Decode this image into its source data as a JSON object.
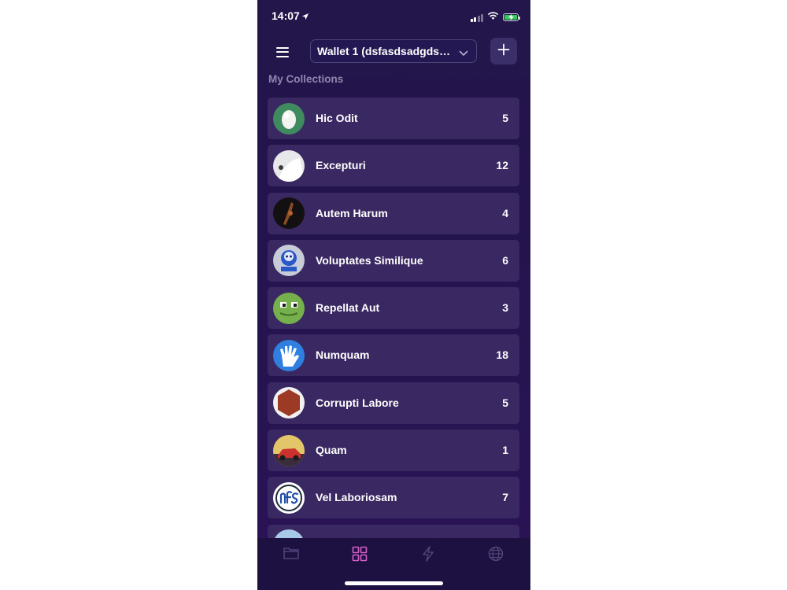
{
  "status_bar": {
    "time": "14:07"
  },
  "header": {
    "wallet_label": "Wallet 1 (dsfasdsadgdsff..."
  },
  "section": {
    "title": "My Collections"
  },
  "collections": [
    {
      "name": "Hic Odit",
      "count": "5",
      "avatar": "egg-avatar"
    },
    {
      "name": "Excepturi",
      "count": "12",
      "avatar": "white-object-avatar"
    },
    {
      "name": "Autem Harum",
      "count": "4",
      "avatar": "dark-figure-avatar"
    },
    {
      "name": "Voluptates Similique",
      "count": "6",
      "avatar": "blue-badge-avatar"
    },
    {
      "name": "Repellat Aut",
      "count": "3",
      "avatar": "frog-avatar"
    },
    {
      "name": "Numquam",
      "count": "18",
      "avatar": "hand-avatar"
    },
    {
      "name": "Corrupti Labore",
      "count": "5",
      "avatar": "red-hexagon-avatar"
    },
    {
      "name": "Quam",
      "count": "1",
      "avatar": "car-avatar"
    },
    {
      "name": "Vel Laboriosam",
      "count": "7",
      "avatar": "nfs-logo-avatar"
    }
  ],
  "colors": {
    "background": "#24144e",
    "row": "#3a2862",
    "section_title": "#8f86b0",
    "active_tab": "#d660c8",
    "inactive_tab": "#4e4478"
  },
  "tabs": [
    {
      "icon": "folder-icon",
      "active": false
    },
    {
      "icon": "grid-icon",
      "active": true
    },
    {
      "icon": "lightning-icon",
      "active": false
    },
    {
      "icon": "globe-icon",
      "active": false
    }
  ]
}
